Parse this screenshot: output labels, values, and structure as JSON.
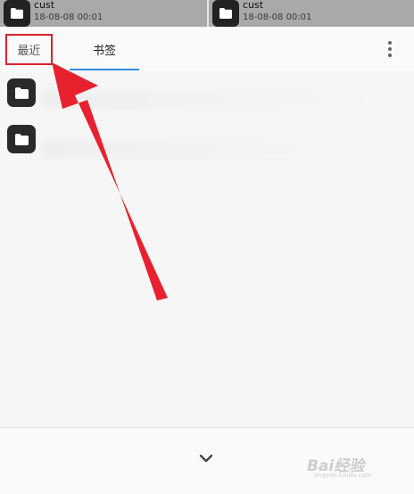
{
  "background_files": [
    {
      "name": "cust",
      "date": "18-08-08 00:01",
      "icon": "folder-icon"
    },
    {
      "name": "cust",
      "date": "18-08-08 00:01",
      "icon": "folder-icon"
    }
  ],
  "tabs": [
    {
      "label": "最近",
      "active": false,
      "highlighted": true
    },
    {
      "label": "书签",
      "active": true
    }
  ],
  "more_icon": "more-vert-icon",
  "recent_items": [
    {
      "icon": "folder-icon",
      "label": ""
    },
    {
      "icon": "folder-icon",
      "label": ""
    }
  ],
  "bottom_icon": "chevron-down-icon",
  "watermark": {
    "text": "Bai经验",
    "subtext": "jingyan.baidu.com"
  },
  "colors": {
    "highlight_border": "#d9232d",
    "arrow": "#e8212f",
    "tab_underline": "#2f8ddc",
    "folder_tile": "#2a2a2a"
  }
}
